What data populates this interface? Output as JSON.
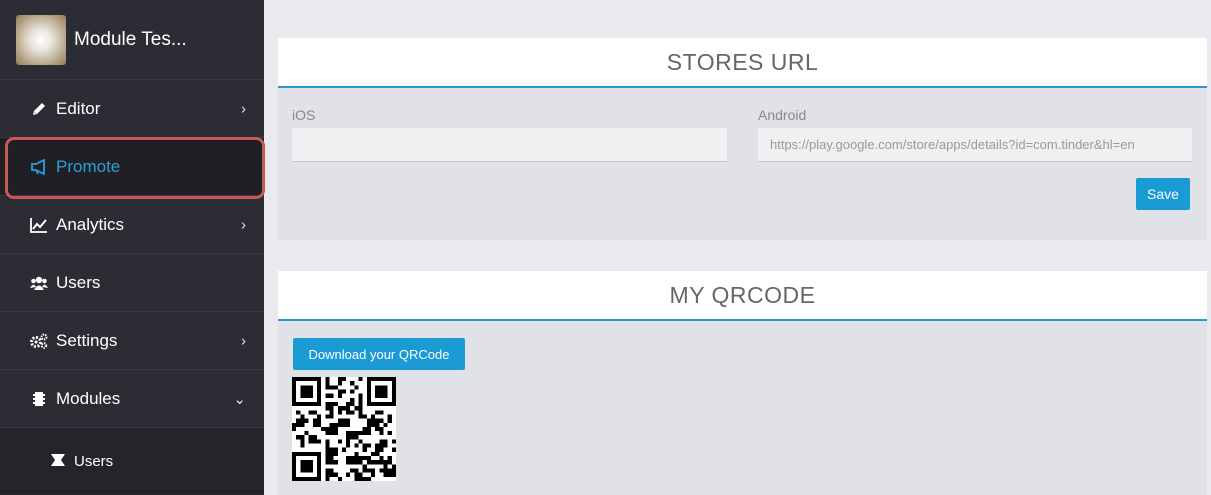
{
  "sidebar": {
    "app_name": "Module Tes...",
    "items": [
      {
        "label": "Editor",
        "icon": "pencil-icon",
        "chevron": "›"
      },
      {
        "label": "Promote",
        "icon": "megaphone-icon",
        "chevron": ""
      },
      {
        "label": "Analytics",
        "icon": "chart-icon",
        "chevron": "›"
      },
      {
        "label": "Users",
        "icon": "users-icon",
        "chevron": ""
      },
      {
        "label": "Settings",
        "icon": "gears-icon",
        "chevron": "›"
      },
      {
        "label": "Modules",
        "icon": "module-icon",
        "chevron": "⌄"
      }
    ],
    "subitems": [
      {
        "label": "Users",
        "icon": "puzzle-icon"
      }
    ]
  },
  "stores": {
    "title": "STORES URL",
    "ios_label": "iOS",
    "ios_value": "",
    "android_label": "Android",
    "android_value": "https://play.google.com/store/apps/details?id=com.tinder&hl=en",
    "save_label": "Save"
  },
  "qrcode": {
    "title": "MY QRCODE",
    "download_label": "Download your QRCode"
  },
  "colors": {
    "accent": "#1a9bd3",
    "sidebar_bg": "#2c2c34",
    "active_text": "#2a9fd8",
    "highlight": "#c65a57"
  }
}
